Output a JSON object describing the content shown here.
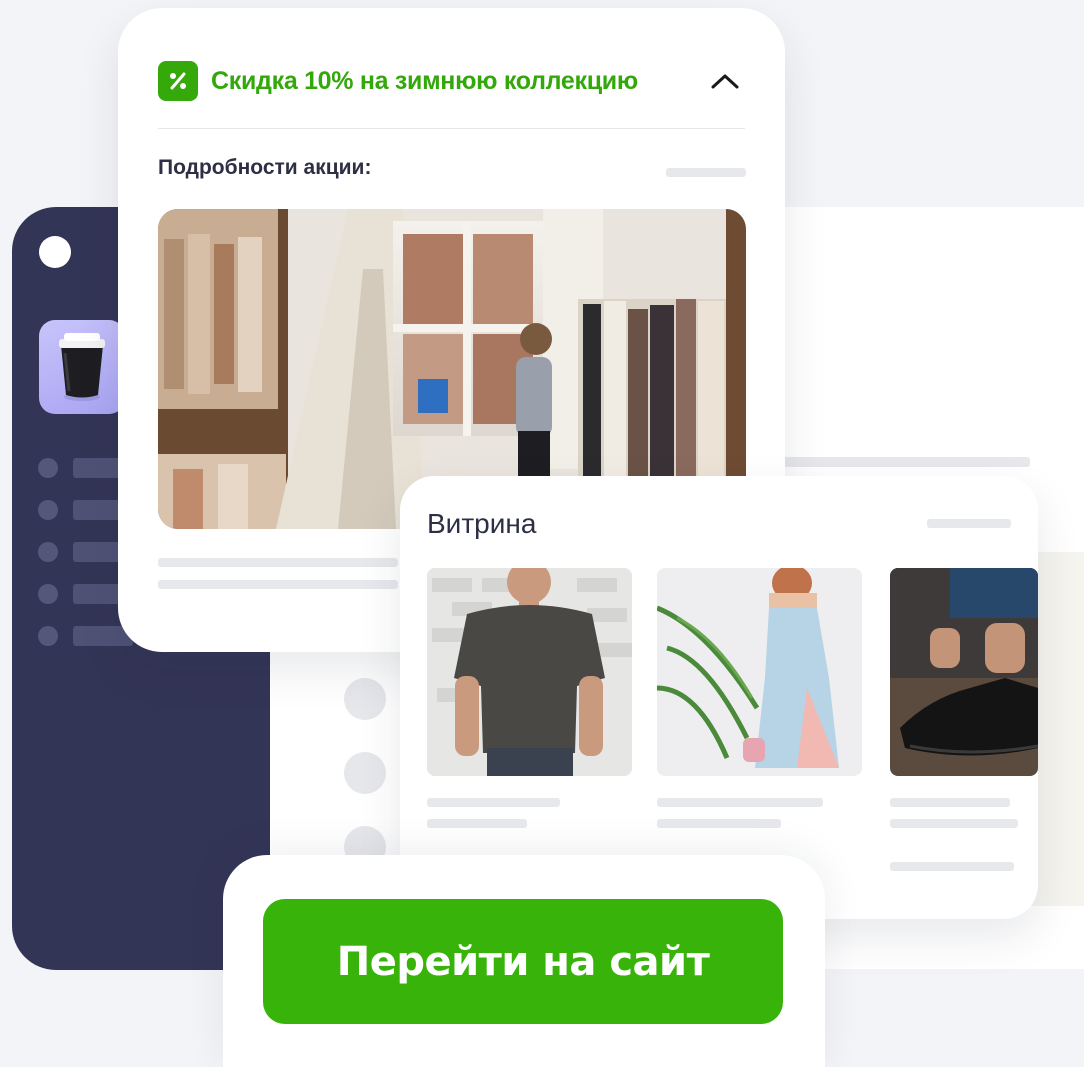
{
  "promo": {
    "title": "Скидка 10% на зимнюю коллекцию",
    "details_label": "Подробности акции:",
    "badge_icon": "percent-icon",
    "collapse_icon": "chevron-up-icon",
    "accent_color": "#33a80a"
  },
  "showcase": {
    "title": "Витрина",
    "products": [
      {
        "image": "t-shirt-photo"
      },
      {
        "image": "dress-photo"
      },
      {
        "image": "shoes-photo"
      }
    ]
  },
  "cta": {
    "label": "Перейти на сайт",
    "color": "#38b30a"
  },
  "sidebar": {
    "app_icon": "coffee-cup-icon",
    "color": "#333556"
  }
}
